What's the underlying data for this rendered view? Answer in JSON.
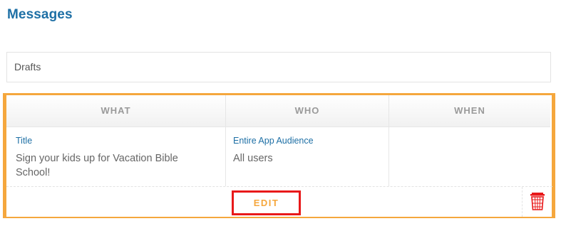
{
  "page": {
    "title": "Messages"
  },
  "drafts": {
    "label": "Drafts"
  },
  "card": {
    "columns": {
      "what": "WHAT",
      "who": "WHO",
      "when": "WHEN"
    },
    "what": {
      "link": "Title",
      "text_line1": "Sign your kids up for Vacation Bible",
      "text_line2": "School!"
    },
    "who": {
      "link": "Entire App Audience",
      "text": "All users"
    },
    "edit_label": "EDIT",
    "accent_color": "#f5a73d",
    "highlight_color": "#e8191a",
    "link_color": "#1d6fa5"
  }
}
